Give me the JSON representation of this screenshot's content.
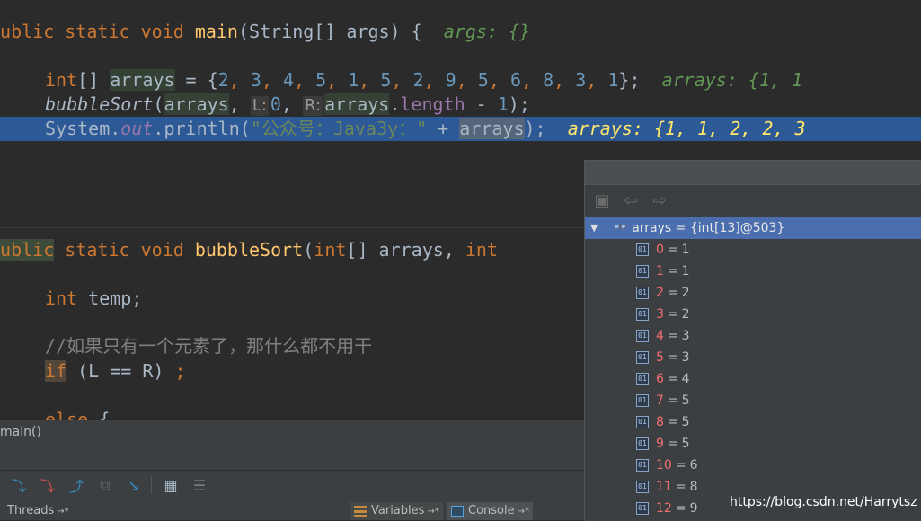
{
  "editor": {
    "line_main": {
      "kw1": "public",
      "kw2": "static",
      "kw3": "void",
      "fn": "main",
      "p1": "(String[] args) {",
      "hint": "args: {}"
    },
    "line_arrays": {
      "type": "int",
      "brackets": "[] ",
      "var": "arrays",
      "eq": " = {",
      "nums": [
        "2",
        "3",
        "4",
        "5",
        "1",
        "5",
        "2",
        "9",
        "5",
        "6",
        "8",
        "3",
        "1"
      ],
      "close": "};",
      "hint": "arrays: {1, 1"
    },
    "line_call": {
      "fn": "bubbleSort",
      "open": "(",
      "var": "arrays",
      "comma": ", ",
      "hint_l": "L:",
      "arg_l": "0",
      "comma2": ", ",
      "hint_r": "R:",
      "var2": "arrays",
      "dot": ".",
      "field": "length",
      "minus": " - ",
      "one": "1",
      "close": ");"
    },
    "line_print": {
      "cls": "System",
      "dot": ".",
      "field": "out",
      "method": ".println(",
      "str": "\"公众号：Java3y：\"",
      "plus": " + ",
      "var": "arrays",
      "close": ");",
      "hint": "arrays: {1, 1, 2, 2, 3"
    },
    "line_brace": "}",
    "line_bubble": {
      "kw1": "public",
      "kw2": "static",
      "kw3": "void",
      "fn": "bubbleSort",
      "open": "(",
      "type1": "int",
      "p1": "[] arrays, ",
      "type2": "int"
    },
    "line_temp": {
      "type": "int",
      "rest": "temp;"
    },
    "line_comment": "//如果只有一个元素了，那什么都不用干",
    "line_if": {
      "kw": "if",
      "rest": " (L == R) ",
      "semi": ";"
    },
    "line_else": {
      "kw": "else",
      "rest": " {"
    }
  },
  "debugger": {
    "frame": "main()",
    "tabs": {
      "threads": "Threads",
      "variables": "Variables",
      "console": "Console",
      "pin": "→*"
    }
  },
  "popup": {
    "root": "arrays = {int[13]@503}",
    "items": [
      {
        "index": "0",
        "value": "1"
      },
      {
        "index": "1",
        "value": "1"
      },
      {
        "index": "2",
        "value": "2"
      },
      {
        "index": "3",
        "value": "2"
      },
      {
        "index": "4",
        "value": "3"
      },
      {
        "index": "5",
        "value": "3"
      },
      {
        "index": "6",
        "value": "4"
      },
      {
        "index": "7",
        "value": "5"
      },
      {
        "index": "8",
        "value": "5"
      },
      {
        "index": "9",
        "value": "5"
      },
      {
        "index": "10",
        "value": "6"
      },
      {
        "index": "11",
        "value": "8"
      },
      {
        "index": "12",
        "value": "9"
      }
    ]
  },
  "watermark": "https://blog.csdn.net/Harrytsz"
}
